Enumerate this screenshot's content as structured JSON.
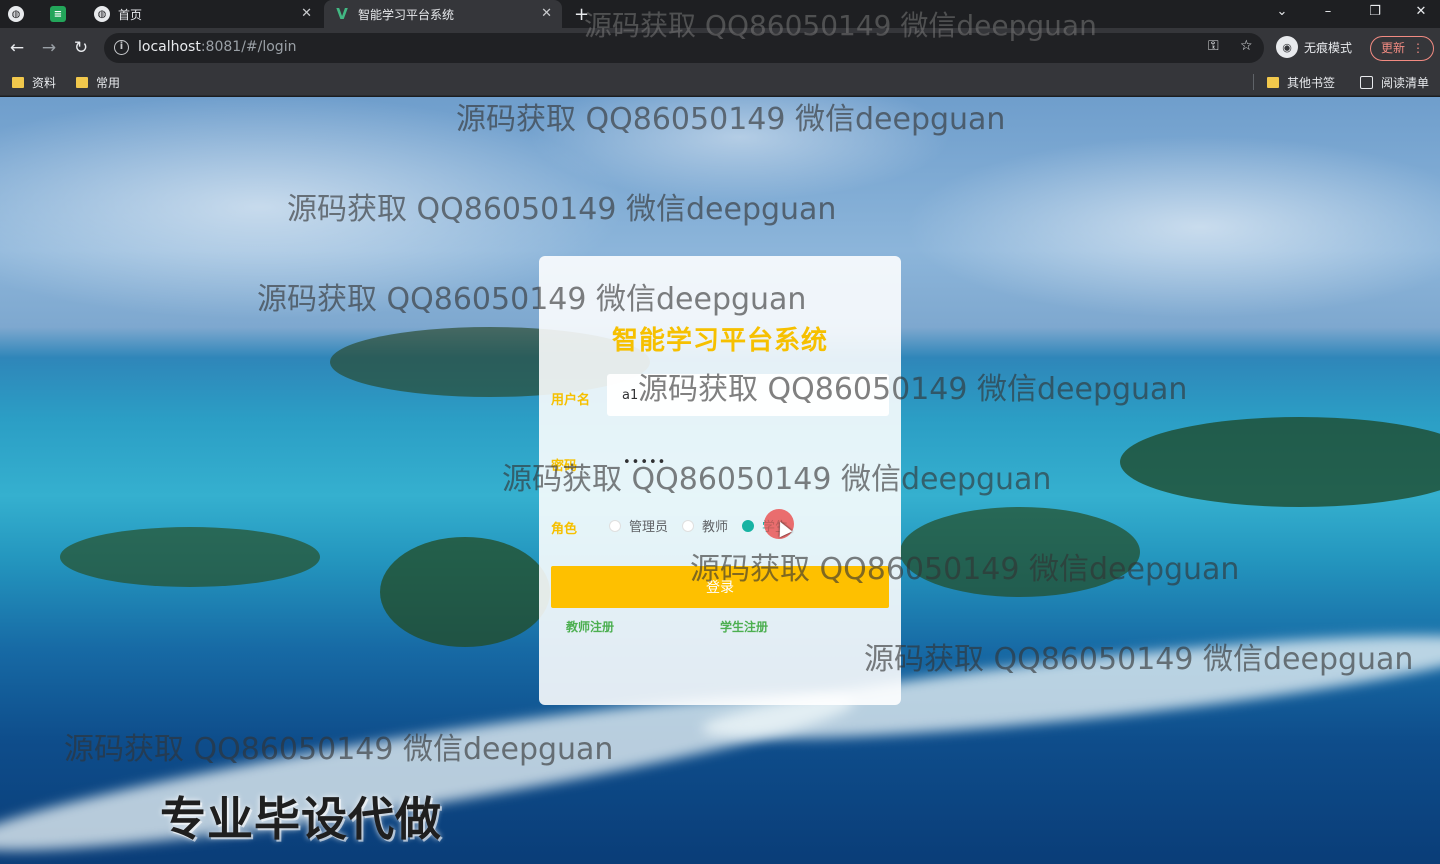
{
  "browser": {
    "tabs": [
      {
        "label": "首页",
        "icon": "globe-icon",
        "active": false
      },
      {
        "label": "智能学习平台系统",
        "icon": "vue-logo-icon",
        "active": true
      }
    ],
    "new_tab_symbol": "+",
    "url_host": "localhost",
    "url_rest": ":8081/#/login",
    "incognito_label": "无痕模式",
    "update_label": "更新",
    "bookmarks": [
      {
        "label": "资料",
        "icon": "folder-icon"
      },
      {
        "label": "常用",
        "icon": "folder-icon"
      }
    ],
    "bookmarks_right": [
      {
        "label": "其他书签",
        "icon": "folder-icon"
      },
      {
        "label": "阅读清单",
        "icon": "reading-list-icon"
      }
    ]
  },
  "login": {
    "title": "智能学习平台系统",
    "username_label": "用户名",
    "username_value": "a1",
    "password_label": "密码",
    "password_value": "•••••",
    "role_label": "角色",
    "roles": [
      {
        "label": "管理员",
        "checked": false
      },
      {
        "label": "教师",
        "checked": false
      },
      {
        "label": "学生",
        "checked": true
      }
    ],
    "login_button": "登录",
    "teacher_register": "教师注册",
    "student_register": "学生注册"
  },
  "overlay": {
    "watermark_text": "源码获取 QQ86050149 微信deepguan",
    "promo_text": "专业毕设代做"
  },
  "colors": {
    "accent_yellow": "#fec000",
    "title_yellow": "#f6c000",
    "radio_checked": "#17b3a3",
    "link_green": "#4caf50"
  }
}
